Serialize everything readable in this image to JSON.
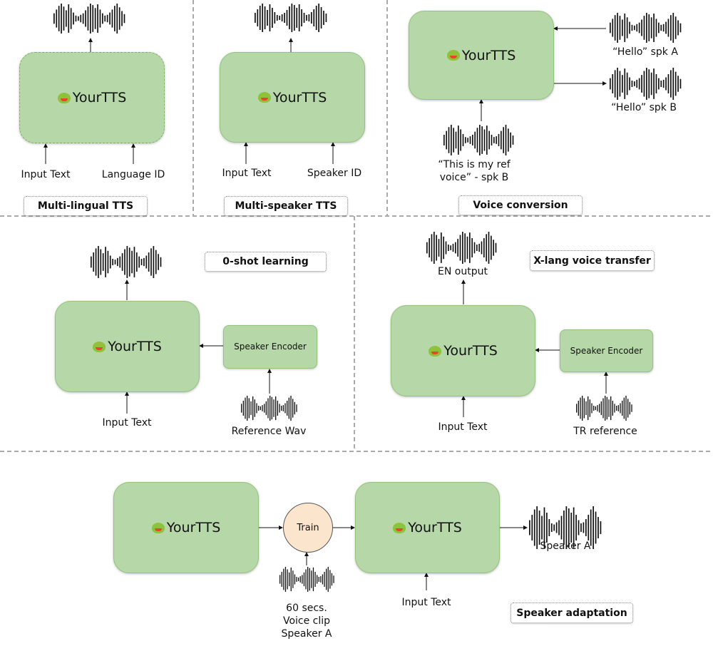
{
  "model_name": "YourTTS",
  "icons": {
    "model": "frog-emoji",
    "audio": "waveform"
  },
  "colors": {
    "model_box": "#b6d7a8",
    "train_node": "#fce5cd"
  },
  "panels": {
    "multilingual": {
      "title": "Multi-lingual TTS",
      "input1": "Input Text",
      "input2": "Language ID"
    },
    "multispeaker": {
      "title": "Multi-speaker TTS",
      "input1": "Input Text",
      "input2": "Speaker ID"
    },
    "voice_conversion": {
      "title": "Voice conversion",
      "src_label": "“Hello” spk A",
      "out_label": "“Hello” spk B",
      "ref_label_1": "“This is my ref",
      "ref_label_2": "voice” -  spk B"
    },
    "zero_shot": {
      "title": "0-shot learning",
      "encoder": "Speaker Encoder",
      "input": "Input Text",
      "ref": "Reference Wav"
    },
    "xlang": {
      "title": "X-lang voice transfer",
      "encoder": "Speaker Encoder",
      "input": "Input Text",
      "ref": "TR reference",
      "output": "EN output"
    },
    "adaptation": {
      "title": "Speaker adaptation",
      "train": "Train",
      "clip_1": "60 secs.",
      "clip_2": "Voice clip",
      "clip_3": "Speaker A",
      "input": "Input Text",
      "output": "Speaker A"
    }
  }
}
